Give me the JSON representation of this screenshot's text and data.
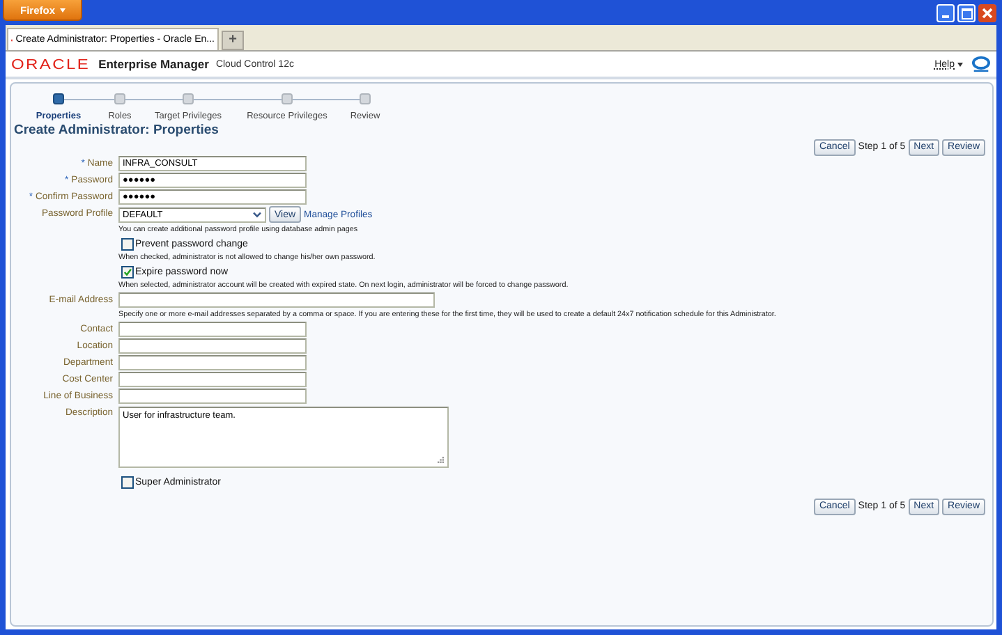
{
  "browser": {
    "menu_button": "Firefox",
    "tab_title": "Create Administrator: Properties - Oracle En...",
    "new_tab": "+"
  },
  "header": {
    "brand": "ORACLE",
    "product": "Enterprise Manager",
    "edition": "Cloud Control 12c",
    "help": "Help"
  },
  "train": [
    {
      "label": "Properties",
      "selected": true
    },
    {
      "label": "Roles",
      "selected": false
    },
    {
      "label": "Target Privileges",
      "selected": false
    },
    {
      "label": "Resource Privileges",
      "selected": false
    },
    {
      "label": "Review",
      "selected": false
    }
  ],
  "page_title": "Create Administrator: Properties",
  "nav_top": {
    "cancel": "Cancel",
    "step": "Step 1 of 5",
    "next": "Next",
    "review": "Review"
  },
  "form": [
    {
      "kind": "text",
      "marker": "*",
      "label": "Name",
      "value": "INFRA_CONSULT"
    },
    {
      "kind": "text",
      "marker": "*",
      "label": "Password",
      "value": "●●●●●●"
    },
    {
      "kind": "text",
      "marker": "*",
      "label": "Confirm Password",
      "value": "●●●●●●"
    },
    {
      "kind": "select",
      "label": "Password Profile",
      "value": "DEFAULT",
      "button": "View",
      "link": "Manage Profiles"
    },
    {
      "kind": "hint",
      "text": "You can create additional password profile using database admin pages"
    },
    {
      "kind": "checkbox",
      "label": "Prevent password change",
      "checked": false
    },
    {
      "kind": "hint",
      "text": "When checked, administrator is not allowed to change his/her own password."
    },
    {
      "kind": "checkbox",
      "label": "Expire password now",
      "checked": true
    },
    {
      "kind": "hint",
      "text": "When selected, administrator account will be created with expired state. On next login, administrator will be forced to change password."
    },
    {
      "kind": "wide",
      "label": "E-mail Address"
    },
    {
      "kind": "hint",
      "text": "Specify one or more e-mail addresses separated by a comma or space. If you are entering these for the first time, they will be used to create a default 24x7 notification schedule for this Administrator."
    },
    {
      "kind": "text",
      "label": "Contact"
    },
    {
      "kind": "text",
      "label": "Location"
    },
    {
      "kind": "text",
      "label": "Department"
    },
    {
      "kind": "text",
      "label": "Cost Center"
    },
    {
      "kind": "text",
      "label": "Line of Business"
    },
    {
      "kind": "textarea",
      "label": "Description",
      "value": "User for infrastructure team."
    },
    {
      "kind": "checkbox",
      "label": "Super Administrator",
      "checked": false
    }
  ],
  "nav_bottom": {
    "cancel": "Cancel",
    "step": "Step 1 of 5",
    "next": "Next",
    "review": "Review"
  }
}
